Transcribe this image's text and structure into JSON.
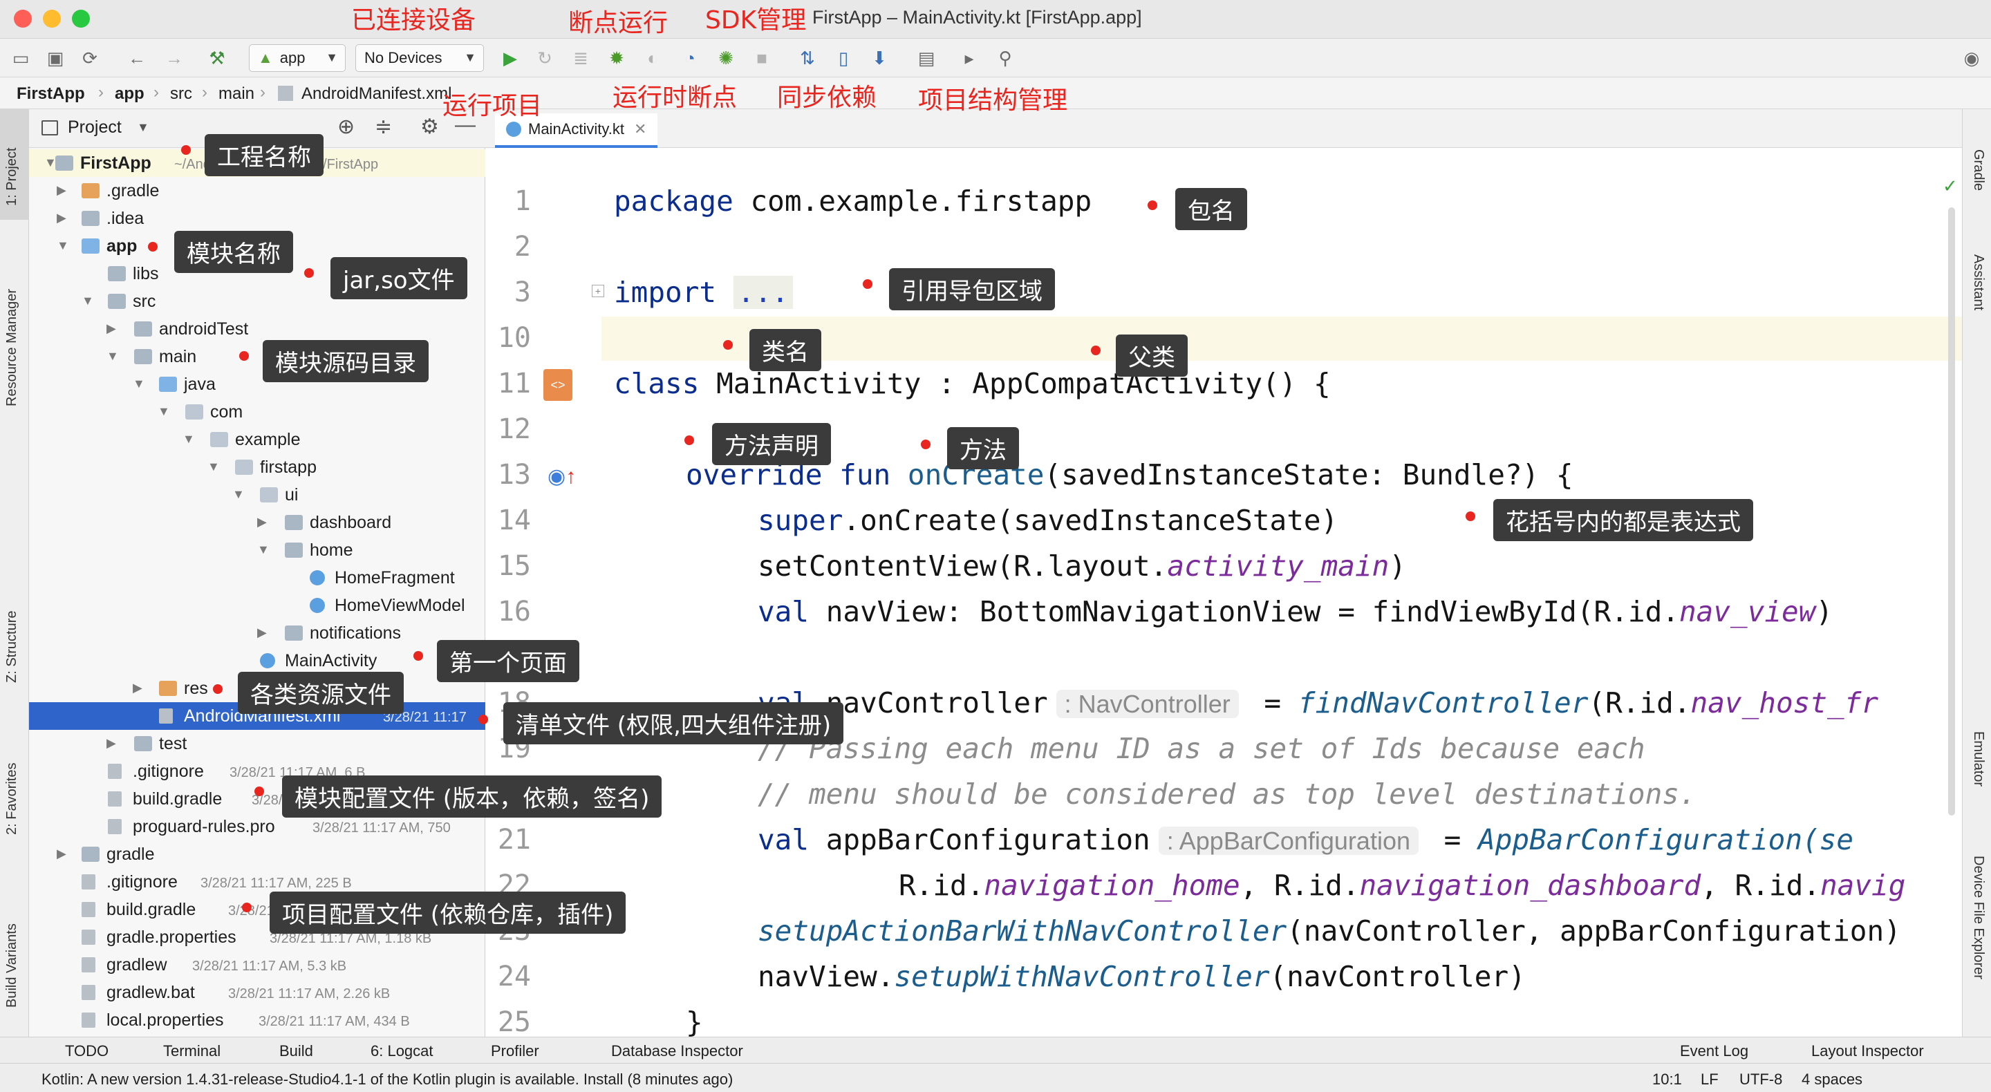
{
  "window": {
    "title": "FirstApp – MainActivity.kt [FirstApp.app]",
    "traffic_colors": [
      "#ff5f57",
      "#febc2e",
      "#28c840"
    ]
  },
  "toolbar": {
    "run_config": "app",
    "device": "No Devices",
    "icons": [
      "open-icon",
      "save-icon",
      "sync-icon",
      "back-icon",
      "forward-icon",
      "hammer-icon",
      "run-icon",
      "apply-changes-icon",
      "debug-icon",
      "attach-debugger-icon",
      "profile-icon",
      "attach-process-icon",
      "stop-icon",
      "gradle-sync-icon",
      "avd-manager-icon",
      "sdk-manager-icon",
      "project-structure-icon",
      "layout-inspector-icon",
      "search-icon"
    ]
  },
  "breadcrumb": [
    "FirstApp",
    "app",
    "src",
    "main",
    "AndroidManifest.xml"
  ],
  "left_stripe": [
    "1: Project",
    "Resource Manager",
    "Z: Structure",
    "2: Favorites",
    "Build Variants"
  ],
  "right_stripe": [
    "Gradle",
    "Assistant",
    "Emulator",
    "Device File Explorer"
  ],
  "project_panel": {
    "header": "Project",
    "rows": [
      {
        "label": "FirstApp",
        "meta": "~/AndroidStudioProjects/FirstApp"
      },
      {
        "label": ".gradle",
        "meta": ""
      },
      {
        "label": ".idea",
        "meta": ""
      },
      {
        "label": "app",
        "meta": ""
      },
      {
        "label": "libs",
        "meta": ""
      },
      {
        "label": "src",
        "meta": ""
      },
      {
        "label": "androidTest",
        "meta": ""
      },
      {
        "label": "main",
        "meta": ""
      },
      {
        "label": "java",
        "meta": ""
      },
      {
        "label": "com",
        "meta": ""
      },
      {
        "label": "example",
        "meta": ""
      },
      {
        "label": "firstapp",
        "meta": ""
      },
      {
        "label": "ui",
        "meta": ""
      },
      {
        "label": "dashboard",
        "meta": ""
      },
      {
        "label": "home",
        "meta": ""
      },
      {
        "label": "HomeFragment",
        "meta": ""
      },
      {
        "label": "HomeViewModel",
        "meta": ""
      },
      {
        "label": "notifications",
        "meta": ""
      },
      {
        "label": "MainActivity",
        "meta": ""
      },
      {
        "label": "res",
        "meta": ""
      },
      {
        "label": "AndroidManifest.xml",
        "meta": "3/28/21 11:17"
      },
      {
        "label": "test",
        "meta": ""
      },
      {
        "label": ".gitignore",
        "meta": "3/28/21 11:17 AM, 6 B"
      },
      {
        "label": "build.gradle",
        "meta": "3/28/21"
      },
      {
        "label": "proguard-rules.pro",
        "meta": "3/28/21 11:17 AM, 750"
      },
      {
        "label": "gradle",
        "meta": ""
      },
      {
        "label": ".gitignore",
        "meta": "3/28/21 11:17 AM, 225 B"
      },
      {
        "label": "build.gradle",
        "meta": "3/28/21"
      },
      {
        "label": "gradle.properties",
        "meta": "3/28/21 11:17 AM, 1.18 kB"
      },
      {
        "label": "gradlew",
        "meta": "3/28/21 11:17 AM, 5.3 kB"
      },
      {
        "label": "gradlew.bat",
        "meta": "3/28/21 11:17 AM, 2.26 kB"
      },
      {
        "label": "local.properties",
        "meta": "3/28/21 11:17 AM, 434 B"
      }
    ]
  },
  "editor": {
    "tab": "MainActivity.kt",
    "line_numbers": [
      "1",
      "2",
      "3",
      "10",
      "11",
      "12",
      "13",
      "14",
      "15",
      "16",
      "18",
      "19",
      "20",
      "21",
      "22",
      "23",
      "24",
      "25"
    ],
    "code": {
      "l1_kw": "package",
      "l1_rest": " com.example.firstapp",
      "l3_kw": "import",
      "l3_fold": "...",
      "l11_kw": "class",
      "l11_rest": " MainActivity : AppCompatActivity() {",
      "l13_kw1": "override",
      "l13_kw2": "fun",
      "l13_fn": "onCreate",
      "l13_rest": "(savedInstanceState: Bundle?) {",
      "l14_kw": "super",
      "l14_rest": ".onCreate(savedInstanceState)",
      "l15_a": "setContentView(R.layout.",
      "l15_it": "activity_main",
      "l15_b": ")",
      "l16_kw": "val",
      "l16_a": " navView: BottomNavigationView = findViewById(R.id.",
      "l16_it": "nav_view",
      "l16_b": ")",
      "l18_kw": "val",
      "l18_a": " navController",
      "l18_hint": ": NavController",
      "l18_b": " = ",
      "l18_fn": "findNavController",
      "l18_c": "(R.id.",
      "l18_it": "nav_host_fr",
      "l19_cm": "// Passing each menu ID as a set of Ids because each",
      "l20_cm": "// menu should be considered as top level destinations.",
      "l21_kw": "val",
      "l21_a": " appBarConfiguration",
      "l21_hint": ": AppBarConfiguration",
      "l21_b": " = ",
      "l21_fn": "AppBarConfiguration(se",
      "l22_a": "R.id.",
      "l22_it1": "navigation_home",
      "l22_b": ", R.id.",
      "l22_it2": "navigation_dashboard",
      "l22_c": ", R.id.",
      "l22_it3": "navig",
      "l23_fn": "setupActionBarWithNavController",
      "l23_rest": "(navController, appBarConfiguration)",
      "l24_a": "navView.",
      "l24_fn": "setupWithNavController",
      "l24_b": "(navController)",
      "l25": "}"
    }
  },
  "tool_windows": [
    "TODO",
    "Terminal",
    "Build",
    "6: Logcat",
    "Profiler",
    "Database Inspector",
    "Event Log",
    "Layout Inspector"
  ],
  "status": {
    "message": "Kotlin: A new version 1.4.31-release-Studio4.1-1 of the Kotlin plugin is available. Install (8 minutes ago)",
    "position": "10:1",
    "line_sep": "LF",
    "encoding": "UTF-8",
    "indent": "4 spaces"
  },
  "annotations": {
    "toolbar_labels": [
      "已连接设备",
      "断点运行",
      "SDK管理",
      "运行项目",
      "运行时断点",
      "同步依赖",
      "项目结构管理"
    ],
    "callouts": [
      "工程名称",
      "模块名称",
      "jar,so文件",
      "模块源码目录",
      "第一个页面",
      "各类资源文件",
      "清单文件 (权限,四大组件注册)",
      "模块配置文件 (版本，依赖，签名)",
      "项目配置文件 (依赖仓库，插件)",
      "包名",
      "引用导包区域",
      "类名",
      "父类",
      "方法声明",
      "方法",
      "花括号内的都是表达式"
    ],
    "accent": "#e8261f"
  }
}
